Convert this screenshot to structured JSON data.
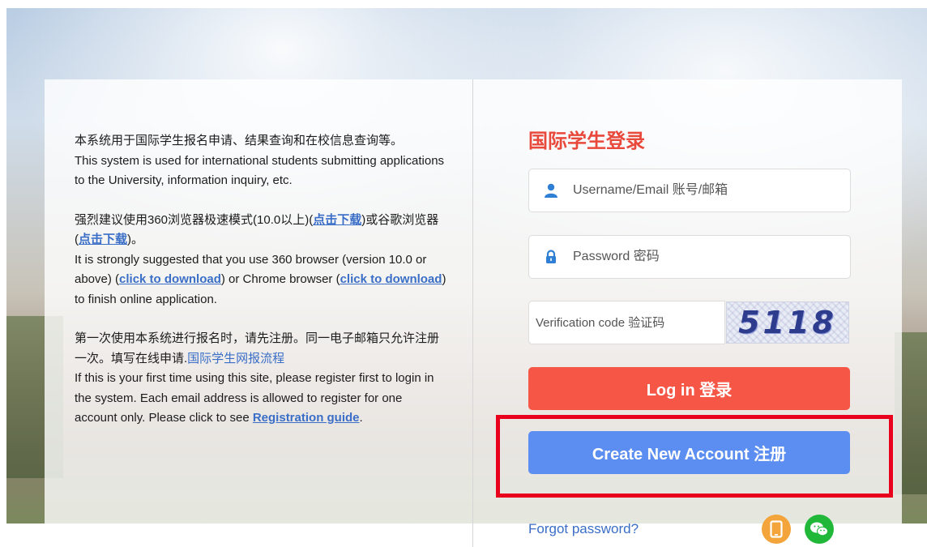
{
  "info": {
    "line1_cn": "本系统用于国际学生报名申请、结果查询和在校信息查询等。",
    "line1_en": "This system is used for international students submitting applications to the University, information inquiry, etc.",
    "p2_cn_a": "强烈建议使用360浏览器极速模式(10.0以上)(",
    "p2_link1_cn": "点击下载",
    "p2_cn_b": ")或谷歌浏览器(",
    "p2_link2_cn": "点击下载",
    "p2_cn_c": ")。",
    "p2_en_a": "It is strongly suggested that you use 360 browser (version 10.0 or above) (",
    "p2_link1_en": "click to download",
    "p2_en_b": ") or Chrome browser (",
    "p2_link2_en": "click to download",
    "p2_en_c": ") to finish online application.",
    "p3_cn_a": "第一次使用本系统进行报名时，请先注册。同一电子邮箱只允许注册一次。填写在线申请.",
    "p3_link_cn": "国际学生网报流程",
    "p3_en_a": "If this is your first time using this site, please register first to login in the system. Each email address is allowed to register for one account only. Please click to see ",
    "p3_link_en": "Registration guide",
    "p3_en_b": "."
  },
  "login": {
    "title": "国际学生登录",
    "username_placeholder": "Username/Email 账号/邮箱",
    "password_placeholder": "Password 密码",
    "verification_placeholder": "Verification code 验证码",
    "captcha_text": "5118",
    "login_button": "Log in 登录",
    "create_button": "Create New Account 注册",
    "forgot_link": "Forgot password?"
  },
  "icons": {
    "user": "user-icon",
    "lock": "lock-icon",
    "mobile": "mobile-icon",
    "wechat": "wechat-icon"
  },
  "colors": {
    "title": "#e8493b",
    "login_button": "#f55645",
    "create_button": "#5b8ef0",
    "link": "#3a6ec7",
    "highlight": "#e8001c",
    "mobile_icon_bg": "#f3a43a",
    "wechat_icon_bg": "#21b83a"
  }
}
